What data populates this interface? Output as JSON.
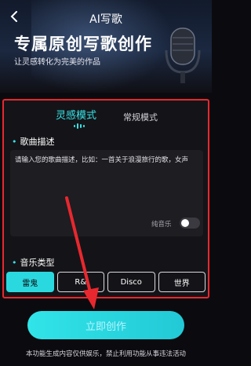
{
  "header": {
    "title": "AI写歌",
    "headline": "专属原创写歌创作",
    "subline": "让灵感转化为完美的作品"
  },
  "tabs": [
    {
      "label": "灵感模式",
      "active": true
    },
    {
      "label": "常规模式",
      "active": false
    }
  ],
  "description": {
    "section_title": "歌曲描述",
    "placeholder": "请输入您的歌曲描述，比如：一首关于浪漫旅行的歌，女声"
  },
  "pure_music": {
    "label": "纯音乐",
    "enabled": false
  },
  "genre": {
    "section_title": "音乐类型",
    "options": [
      {
        "label": "雷鬼",
        "selected": true
      },
      {
        "label": "R&",
        "selected": false
      },
      {
        "label": "Disco",
        "selected": false
      },
      {
        "label": "世界",
        "selected": false
      }
    ]
  },
  "create_button": {
    "label": "立即创作"
  },
  "disclaimer": "本功能生成内容仅供娱乐，禁止利用功能从事违法活动",
  "colors": {
    "accent": "#2ad9df",
    "highlight_annotation": "#e8282e",
    "background": "#0b0b0f"
  }
}
